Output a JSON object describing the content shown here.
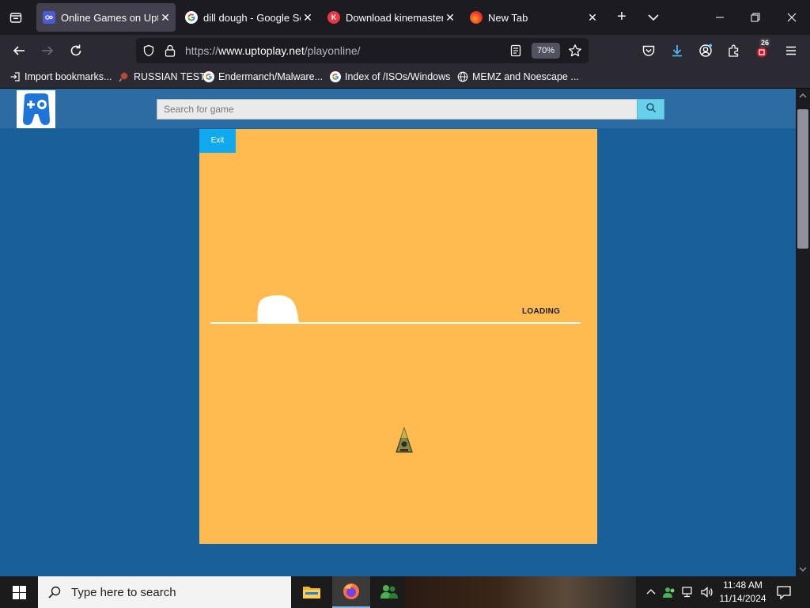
{
  "browser": {
    "tabs": [
      {
        "title": "Online Games on Uptoplay",
        "active": true,
        "favicon": "uptoplay-icon"
      },
      {
        "title": "dill dough - Google Search",
        "active": false,
        "favicon": "google-icon"
      },
      {
        "title": "Download kinemaster",
        "active": false,
        "favicon": "kinemaster-icon"
      },
      {
        "title": "New Tab",
        "active": false,
        "favicon": "firefox-icon"
      }
    ],
    "url_scheme": "https://",
    "url_host": "www.uptoplay.net",
    "url_path": "/playonline/",
    "zoom": "70%",
    "extensions_badge": "26",
    "bookmarks": [
      {
        "label": "Import bookmarks...",
        "icon": "import-icon"
      },
      {
        "label": "RUSSIAN TEST",
        "icon": "magnifier-icon"
      },
      {
        "label": "Endermanch/Malware...",
        "icon": "google-icon"
      },
      {
        "label": "Index of /ISOs/Windows",
        "icon": "google-icon"
      },
      {
        "label": "MEMZ and Noescape ...",
        "icon": "globe-icon"
      }
    ]
  },
  "site": {
    "search_placeholder": "Search for game",
    "exit_label": "Exit",
    "loading_label": "LOADING",
    "loading_progress": 0.25,
    "game_bg": "#ffbb4f",
    "page_bg": "#17609a"
  },
  "taskbar": {
    "search_placeholder": "Type here to search",
    "time": "11:48 AM",
    "date": "11/14/2024"
  }
}
